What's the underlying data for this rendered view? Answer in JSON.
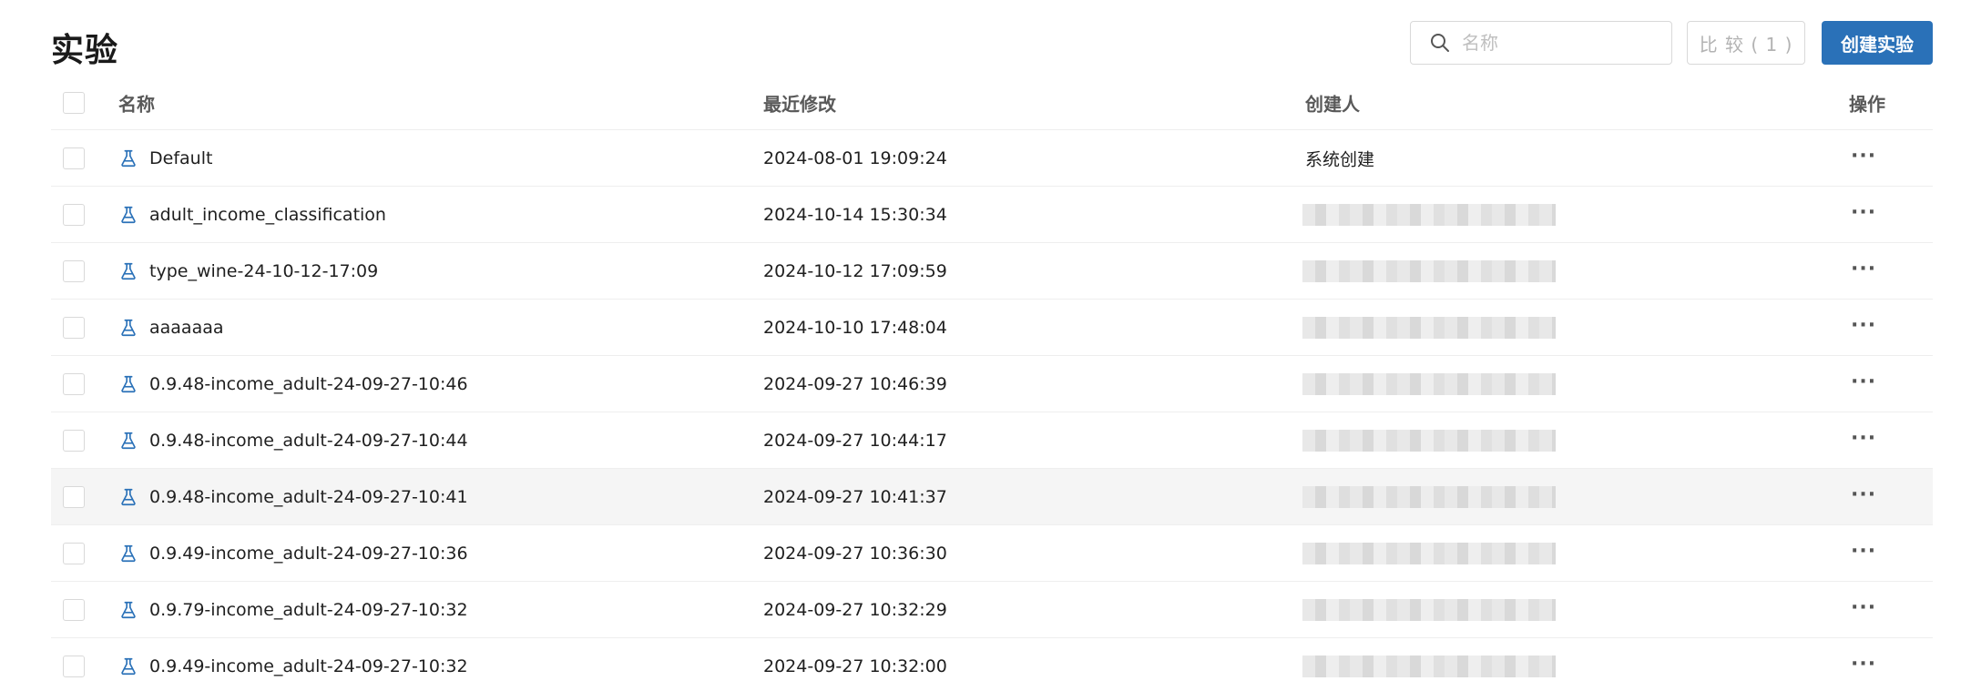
{
  "page": {
    "title": "实验"
  },
  "toolbar": {
    "search_placeholder": "名称",
    "search_value": "",
    "compare_label": "比 较 ( 1 )",
    "create_label": "创建实验"
  },
  "table": {
    "headers": {
      "name": "名称",
      "modified": "最近修改",
      "creator": "创建人",
      "ops": "操作"
    },
    "rows": [
      {
        "name": "Default",
        "modified": "2024-08-01 19:09:24",
        "creator": "系统创建",
        "ops": "···"
      },
      {
        "name": "adult_income_classification",
        "modified": "2024-10-14 15:30:34",
        "creator": "",
        "ops": "···"
      },
      {
        "name": "type_wine-24-10-12-17:09",
        "modified": "2024-10-12 17:09:59",
        "creator": "",
        "ops": "···"
      },
      {
        "name": "aaaaaaa",
        "modified": "2024-10-10 17:48:04",
        "creator": "",
        "ops": "···"
      },
      {
        "name": "0.9.48-income_adult-24-09-27-10:46",
        "modified": "2024-09-27 10:46:39",
        "creator": "",
        "ops": "···"
      },
      {
        "name": "0.9.48-income_adult-24-09-27-10:44",
        "modified": "2024-09-27 10:44:17",
        "creator": "",
        "ops": "···"
      },
      {
        "name": "0.9.48-income_adult-24-09-27-10:41",
        "modified": "2024-09-27 10:41:37",
        "creator": "",
        "ops": "···"
      },
      {
        "name": "0.9.49-income_adult-24-09-27-10:36",
        "modified": "2024-09-27 10:36:30",
        "creator": "",
        "ops": "···"
      },
      {
        "name": "0.9.79-income_adult-24-09-27-10:32",
        "modified": "2024-09-27 10:32:29",
        "creator": "",
        "ops": "···"
      },
      {
        "name": "0.9.49-income_adult-24-09-27-10:32",
        "modified": "2024-09-27 10:32:00",
        "creator": "",
        "ops": "···"
      }
    ]
  },
  "icons": {
    "search": "search-icon",
    "experiment": "flask-icon",
    "more": "more-icon"
  },
  "colors": {
    "accent": "#2a71b8",
    "icon": "#2a71b8",
    "hover_row": "#f5f5f5"
  }
}
